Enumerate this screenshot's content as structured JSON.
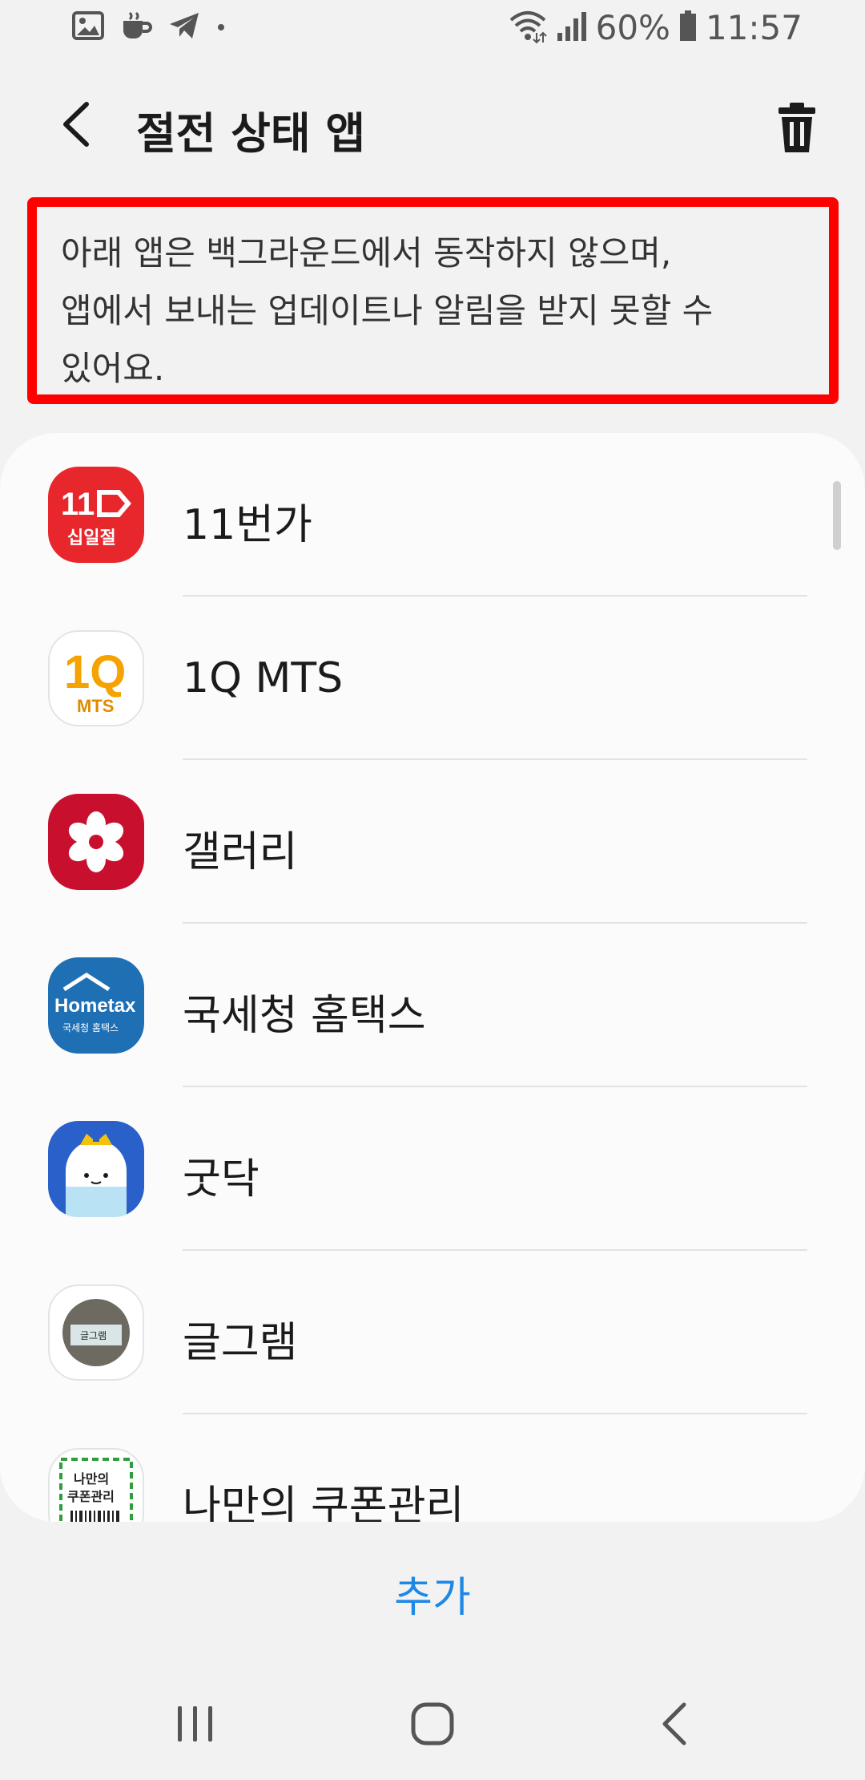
{
  "status_bar": {
    "battery": "60%",
    "time": "11:57",
    "left_icons": [
      "gallery-icon",
      "coffee-icon",
      "telegram-icon",
      "dot-icon"
    ],
    "right_icons": [
      "wifi-icon",
      "signal-icon",
      "battery-icon"
    ]
  },
  "header": {
    "title": "절전 상태 앱",
    "back_icon": "chevron-left-icon",
    "delete_icon": "trash-icon"
  },
  "notice": {
    "line1": "아래 앱은 백그라운드에서 동작하지 않으며,",
    "line2": "앱에서 보내는 업데이트나 알림을 받지 못할 수",
    "line3": "있어요."
  },
  "apps": [
    {
      "label": "11번가",
      "icon": "11st-icon",
      "color": "#e8272d"
    },
    {
      "label": "1Q MTS",
      "icon": "1q-mts-icon",
      "color": "#ffffff"
    },
    {
      "label": "갤러리",
      "icon": "gallery-flower-icon",
      "color": "#c8102e"
    },
    {
      "label": "국세청 홈택스",
      "icon": "hometax-icon",
      "color": "#1f6fb5"
    },
    {
      "label": "굿닥",
      "icon": "goodoc-icon",
      "color": "#2a60c9"
    },
    {
      "label": "글그램",
      "icon": "geulgram-icon",
      "color": "#ffffff"
    },
    {
      "label": "나만의 쿠폰관리",
      "icon": "coupon-icon",
      "color": "#ffffff"
    }
  ],
  "icon_text": {
    "st11_num": "11",
    "st11_sub": "십일절",
    "mts_q": "1Q",
    "mts_sub": "MTS",
    "hometax_main": "Hometax",
    "hometax_sub": "국세청 홈택스",
    "geulgram": "글그램",
    "coupon1": "나만의",
    "coupon2": "쿠폰관리"
  },
  "actions": {
    "add_label": "추가"
  },
  "navbar": {
    "recents_icon": "recents-icon",
    "home_icon": "home-icon",
    "back_icon": "back-icon"
  },
  "colors": {
    "accent": "#1e88e5",
    "highlight_border": "#ff0000"
  }
}
